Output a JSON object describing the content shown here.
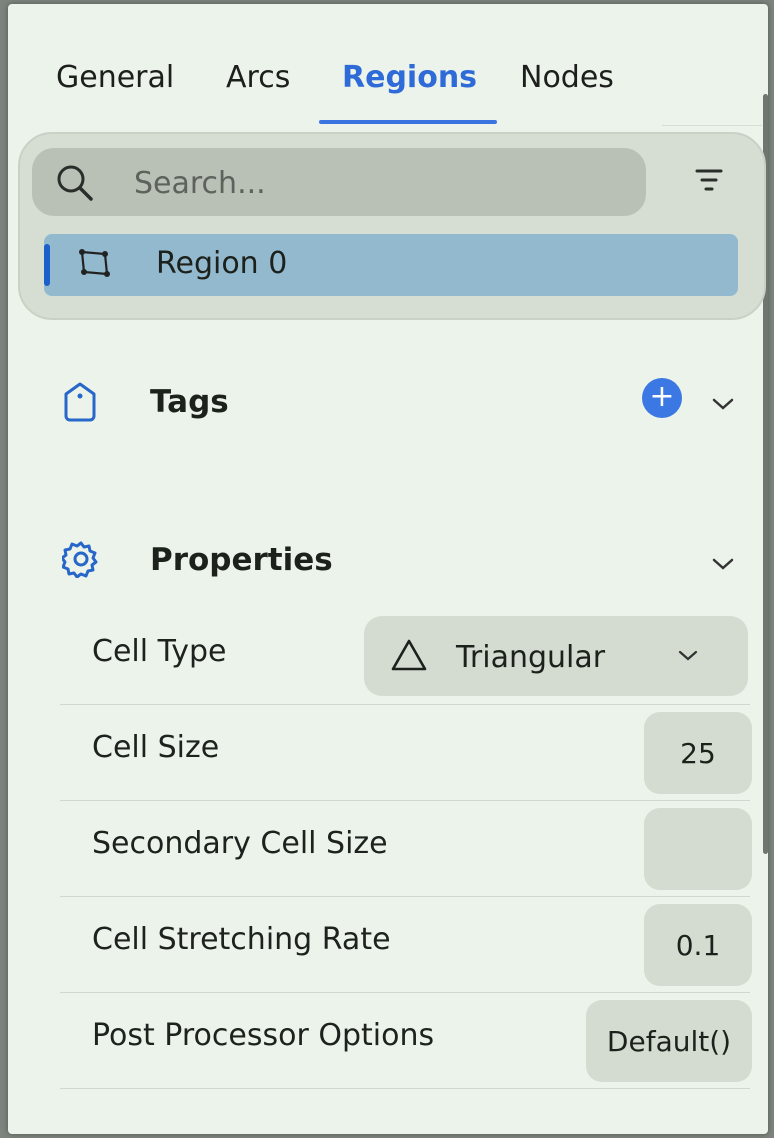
{
  "tabs": [
    {
      "label": "General"
    },
    {
      "label": "Arcs"
    },
    {
      "label": "Regions",
      "active": true
    },
    {
      "label": "Nodes"
    }
  ],
  "search": {
    "placeholder": "Search..."
  },
  "regions": {
    "items": [
      {
        "label": "Region 0",
        "selected": true
      }
    ]
  },
  "tags": {
    "title": "Tags"
  },
  "properties": {
    "title": "Properties",
    "cell_type": {
      "label": "Cell Type",
      "value": "Triangular"
    },
    "cell_size": {
      "label": "Cell Size",
      "value": "25"
    },
    "secondary_cell_size": {
      "label": "Secondary Cell Size",
      "value": ""
    },
    "cell_stretching_rate": {
      "label": "Cell Stretching Rate",
      "value": "0.1"
    },
    "post_processor_options": {
      "label": "Post Processor Options",
      "value": "Default()"
    }
  },
  "colors": {
    "accent": "#2f6ad9",
    "selection": "#93b9cf",
    "panel": "#ecf3ea"
  },
  "icons": [
    "search-icon",
    "filter-icon",
    "region-polygon-icon",
    "tag-icon",
    "plus-icon",
    "gear-icon",
    "chevron-down-icon",
    "triangle-icon"
  ]
}
